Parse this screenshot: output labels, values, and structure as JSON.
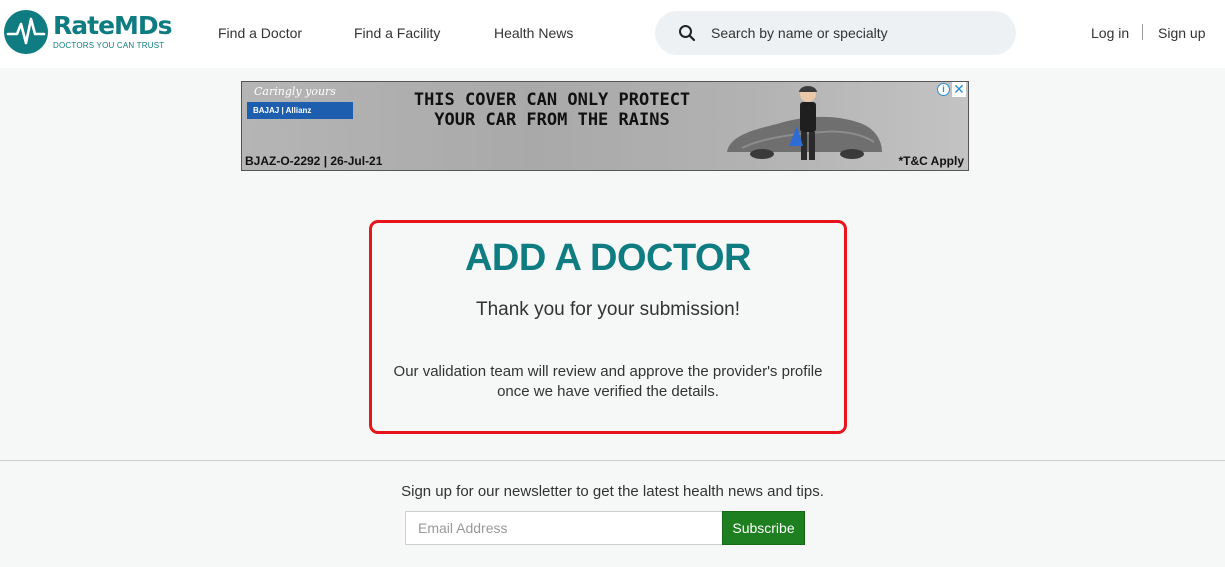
{
  "header": {
    "logo": {
      "name": "RateMDs",
      "name_rate": "Rate",
      "name_mds": "MDs",
      "tagline": "DOCTORS YOU CAN TRUST"
    },
    "nav": [
      {
        "label": "Find a Doctor"
      },
      {
        "label": "Find a Facility"
      },
      {
        "label": "Health News"
      }
    ],
    "search": {
      "placeholder": "Search by name or specialty",
      "icon": "search-icon"
    },
    "auth": {
      "login": "Log in",
      "signup": "Sign up"
    }
  },
  "ad": {
    "script": "Caringly yours",
    "brand": "BAJAJ | Allianz",
    "headline_line1": "THIS COVER CAN ONLY PROTECT",
    "headline_line2": "YOUR CAR FROM THE RAINS",
    "code": "BJAZ-O-2292 | 26-Jul-21",
    "tc": "*T&C Apply",
    "info_icon": "i",
    "close_icon": "✕"
  },
  "confirmation": {
    "title": "ADD A DOCTOR",
    "thanks": "Thank you for your submission!",
    "message": "Our validation team will review and approve the provider's profile once we have verified the details."
  },
  "newsletter": {
    "text": "Sign up for our newsletter to get the latest health news and tips.",
    "email_placeholder": "Email Address",
    "button": "Subscribe"
  },
  "colors": {
    "brand_teal": "#0e7c80",
    "highlight_red": "#e8141c",
    "subscribe_green": "#1d7f1f"
  }
}
